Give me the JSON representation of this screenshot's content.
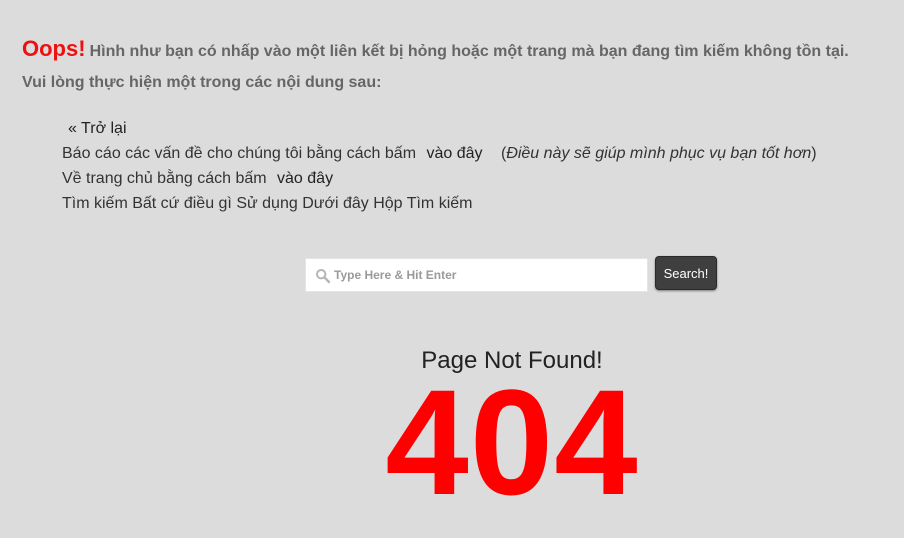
{
  "header": {
    "oops": "Oops!",
    "message": "Hình như bạn có nhấp vào một liên kết bị hỏng hoặc một trang mà bạn đang tìm kiếm không tồn tại."
  },
  "instructions": "Vui lòng thực hiện một trong các nội dung sau:",
  "options": {
    "back_link": "« Trở lại",
    "report_text": "Báo cáo các vấn đề cho chúng tôi bằng cách bấm",
    "report_link": "vào đây",
    "report_note_open": "(",
    "report_note": "Điều này sẽ giúp mình phục vụ bạn tốt hơn",
    "report_note_close": ")",
    "home_text": "Về trang chủ bằng cách bấm",
    "home_link": "vào đây",
    "search_text": "Tìm kiếm Bất cứ điều gì Sử dụng Dưới đây Hộp Tìm kiếm"
  },
  "search": {
    "placeholder": "Type Here & Hit Enter",
    "value": "",
    "button_label": "Search!",
    "icon": "search-icon"
  },
  "error": {
    "title": "Page Not Found!",
    "code": "404"
  },
  "colors": {
    "background": "#dcdcdc",
    "accent_red": "#ff0000",
    "button_dark": "#3f3f3f"
  }
}
